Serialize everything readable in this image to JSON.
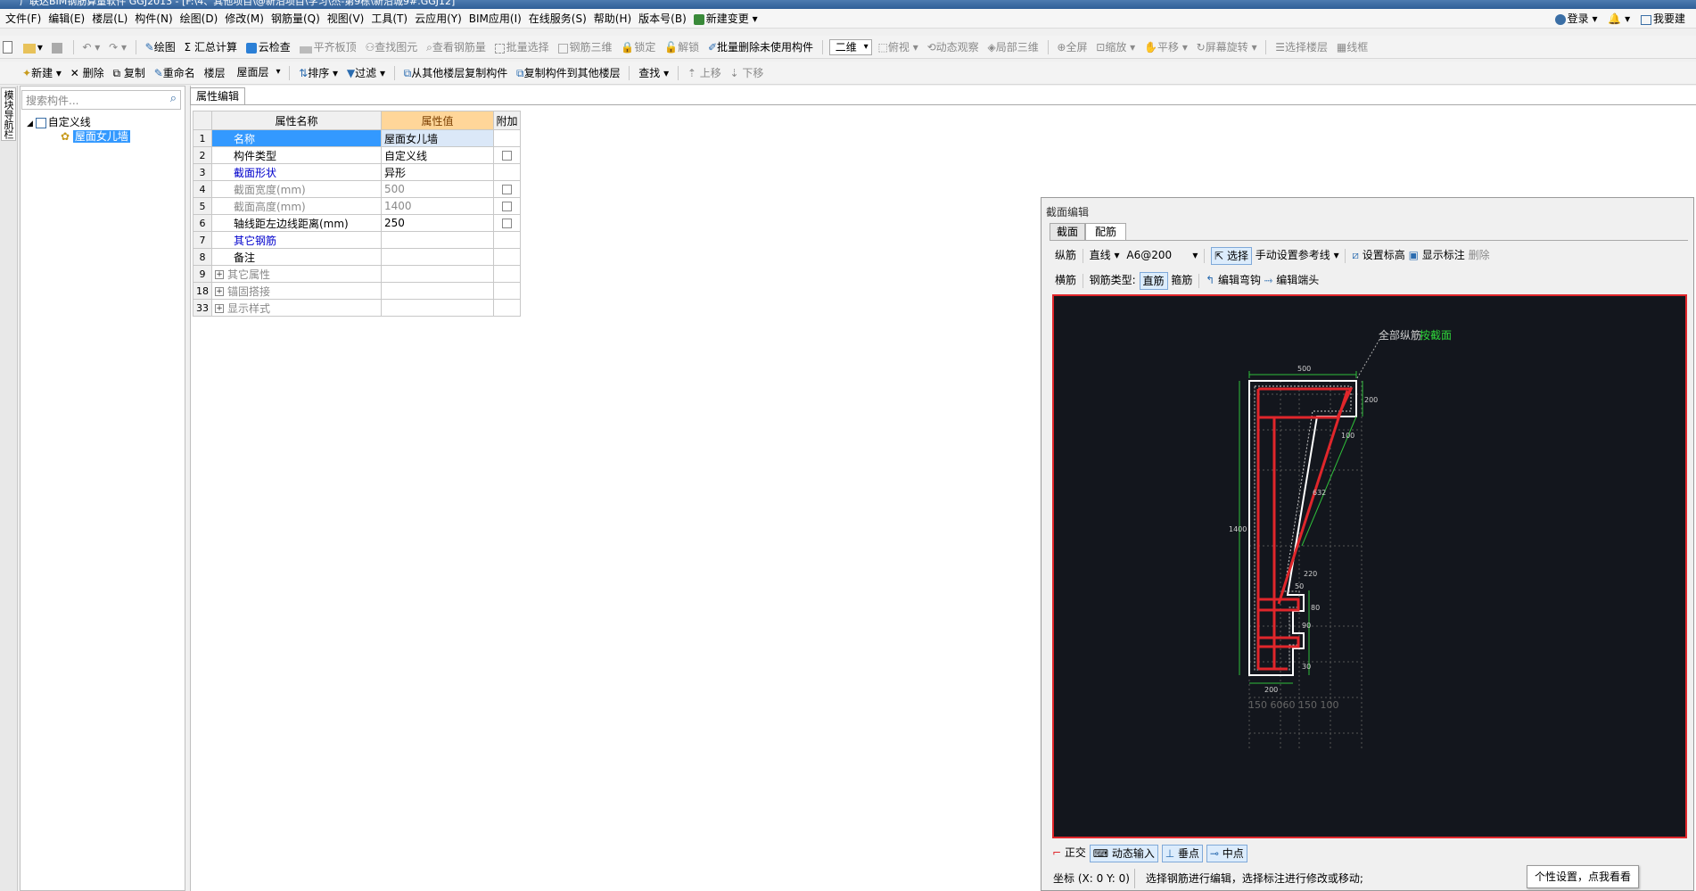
{
  "window": {
    "title": "广联达BIM钢筋算量软件 GGJ2013 - [F:\\4、其他项目\\@新沿项目\\学习\\杰-第9栋\\新沿城9#.GGJ12]"
  },
  "menu": {
    "items": [
      "文件(F)",
      "编辑(E)",
      "楼层(L)",
      "构件(N)",
      "绘图(D)",
      "修改(M)",
      "钢筋量(Q)",
      "视图(V)",
      "工具(T)",
      "云应用(Y)",
      "BIM应用(I)",
      "在线服务(S)",
      "帮助(H)",
      "版本号(B)",
      "新建变更"
    ],
    "login": "登录",
    "help": "我要建"
  },
  "toolbar1": {
    "draw": "绘图",
    "sum": "汇总计算",
    "cloud_check": "云检查",
    "flat_top": "平齐板顶",
    "find_elem": "查找图元",
    "view_rebar": "查看钢筋量",
    "batch_select": "批量选择",
    "rebar_3d": "钢筋三维",
    "lock": "锁定",
    "unlock": "解锁",
    "batch_delete": "批量删除未使用构件",
    "view_mode": "二维",
    "top_view": "俯视",
    "dynamic": "动态观察",
    "local_3d": "局部三维",
    "fullscreen": "全屏",
    "zoom": "缩放",
    "pan": "平移",
    "rotate": "屏幕旋转",
    "select_floor": "选择楼层",
    "wireframe": "线框"
  },
  "toolbar2": {
    "new": "新建",
    "delete": "删除",
    "copy": "复制",
    "rename": "重命名",
    "floor_label": "楼层",
    "floor_value": "屋面层",
    "sort": "排序",
    "filter": "过滤",
    "copy_from": "从其他楼层复制构件",
    "copy_to": "复制构件到其他楼层",
    "find": "查找",
    "up": "上移",
    "down": "下移"
  },
  "side_tab": "模块导航栏",
  "tree": {
    "search_placeholder": "搜索构件...",
    "root": "自定义线",
    "child": "屋面女儿墙"
  },
  "props": {
    "tab": "属性编辑",
    "headers": {
      "name": "属性名称",
      "value": "属性值",
      "extra": "附加"
    },
    "rows": [
      {
        "n": "1",
        "k": "名称",
        "v": "屋面女儿墙"
      },
      {
        "n": "2",
        "k": "构件类型",
        "v": "自定义线"
      },
      {
        "n": "3",
        "k": "截面形状",
        "v": "异形"
      },
      {
        "n": "4",
        "k": "截面宽度(mm)",
        "v": "500"
      },
      {
        "n": "5",
        "k": "截面高度(mm)",
        "v": "1400"
      },
      {
        "n": "6",
        "k": "轴线距左边线距离(mm)",
        "v": "250"
      },
      {
        "n": "7",
        "k": "其它钢筋",
        "v": ""
      },
      {
        "n": "8",
        "k": "备注",
        "v": ""
      },
      {
        "n": "9",
        "k": "其它属性",
        "v": ""
      },
      {
        "n": "18",
        "k": "锚固搭接",
        "v": ""
      },
      {
        "n": "33",
        "k": "显示样式",
        "v": ""
      }
    ]
  },
  "section": {
    "title": "截面编辑",
    "tab_section": "截面",
    "tab_rebar": "配筋",
    "long_bar": "纵筋",
    "line_type": "直线",
    "spec": "A6@200",
    "select": "选择",
    "manual_ref": "手动设置参考线",
    "set_mark": "设置标高",
    "show_mark": "显示标注",
    "delete": "删除",
    "trans_bar": "横筋",
    "bar_type": "钢筋类型:",
    "straight": "直筋",
    "stirrup": "箍筋",
    "edit_hook": "编辑弯钩",
    "edit_end": "编辑端头",
    "callout_a": "全部纵筋",
    "callout_b": "按截面",
    "dims": {
      "top": "500",
      "right_top": "200",
      "left": "1400",
      "bottom": "200",
      "d100": "100",
      "d632": "632",
      "d220": "220",
      "d80": "80",
      "d50": "50",
      "d30": "30",
      "d90": "90"
    },
    "bottom_ticks": "150  6060  150  100",
    "ortho": "正交",
    "dyn_input": "动态输入",
    "perp": "垂点",
    "mid": "中点",
    "coords": "坐标 (X: 0 Y: 0)",
    "status": "选择钢筋进行编辑，选择标注进行修改或移动;",
    "tip": "个性设置，点我看看"
  },
  "colors": {
    "rebar": "#e0262b",
    "canvas_bg": "#13161d",
    "outline": "#ffffff",
    "dim": "#2fbf3a",
    "header_value_bg": "#ffd699"
  }
}
